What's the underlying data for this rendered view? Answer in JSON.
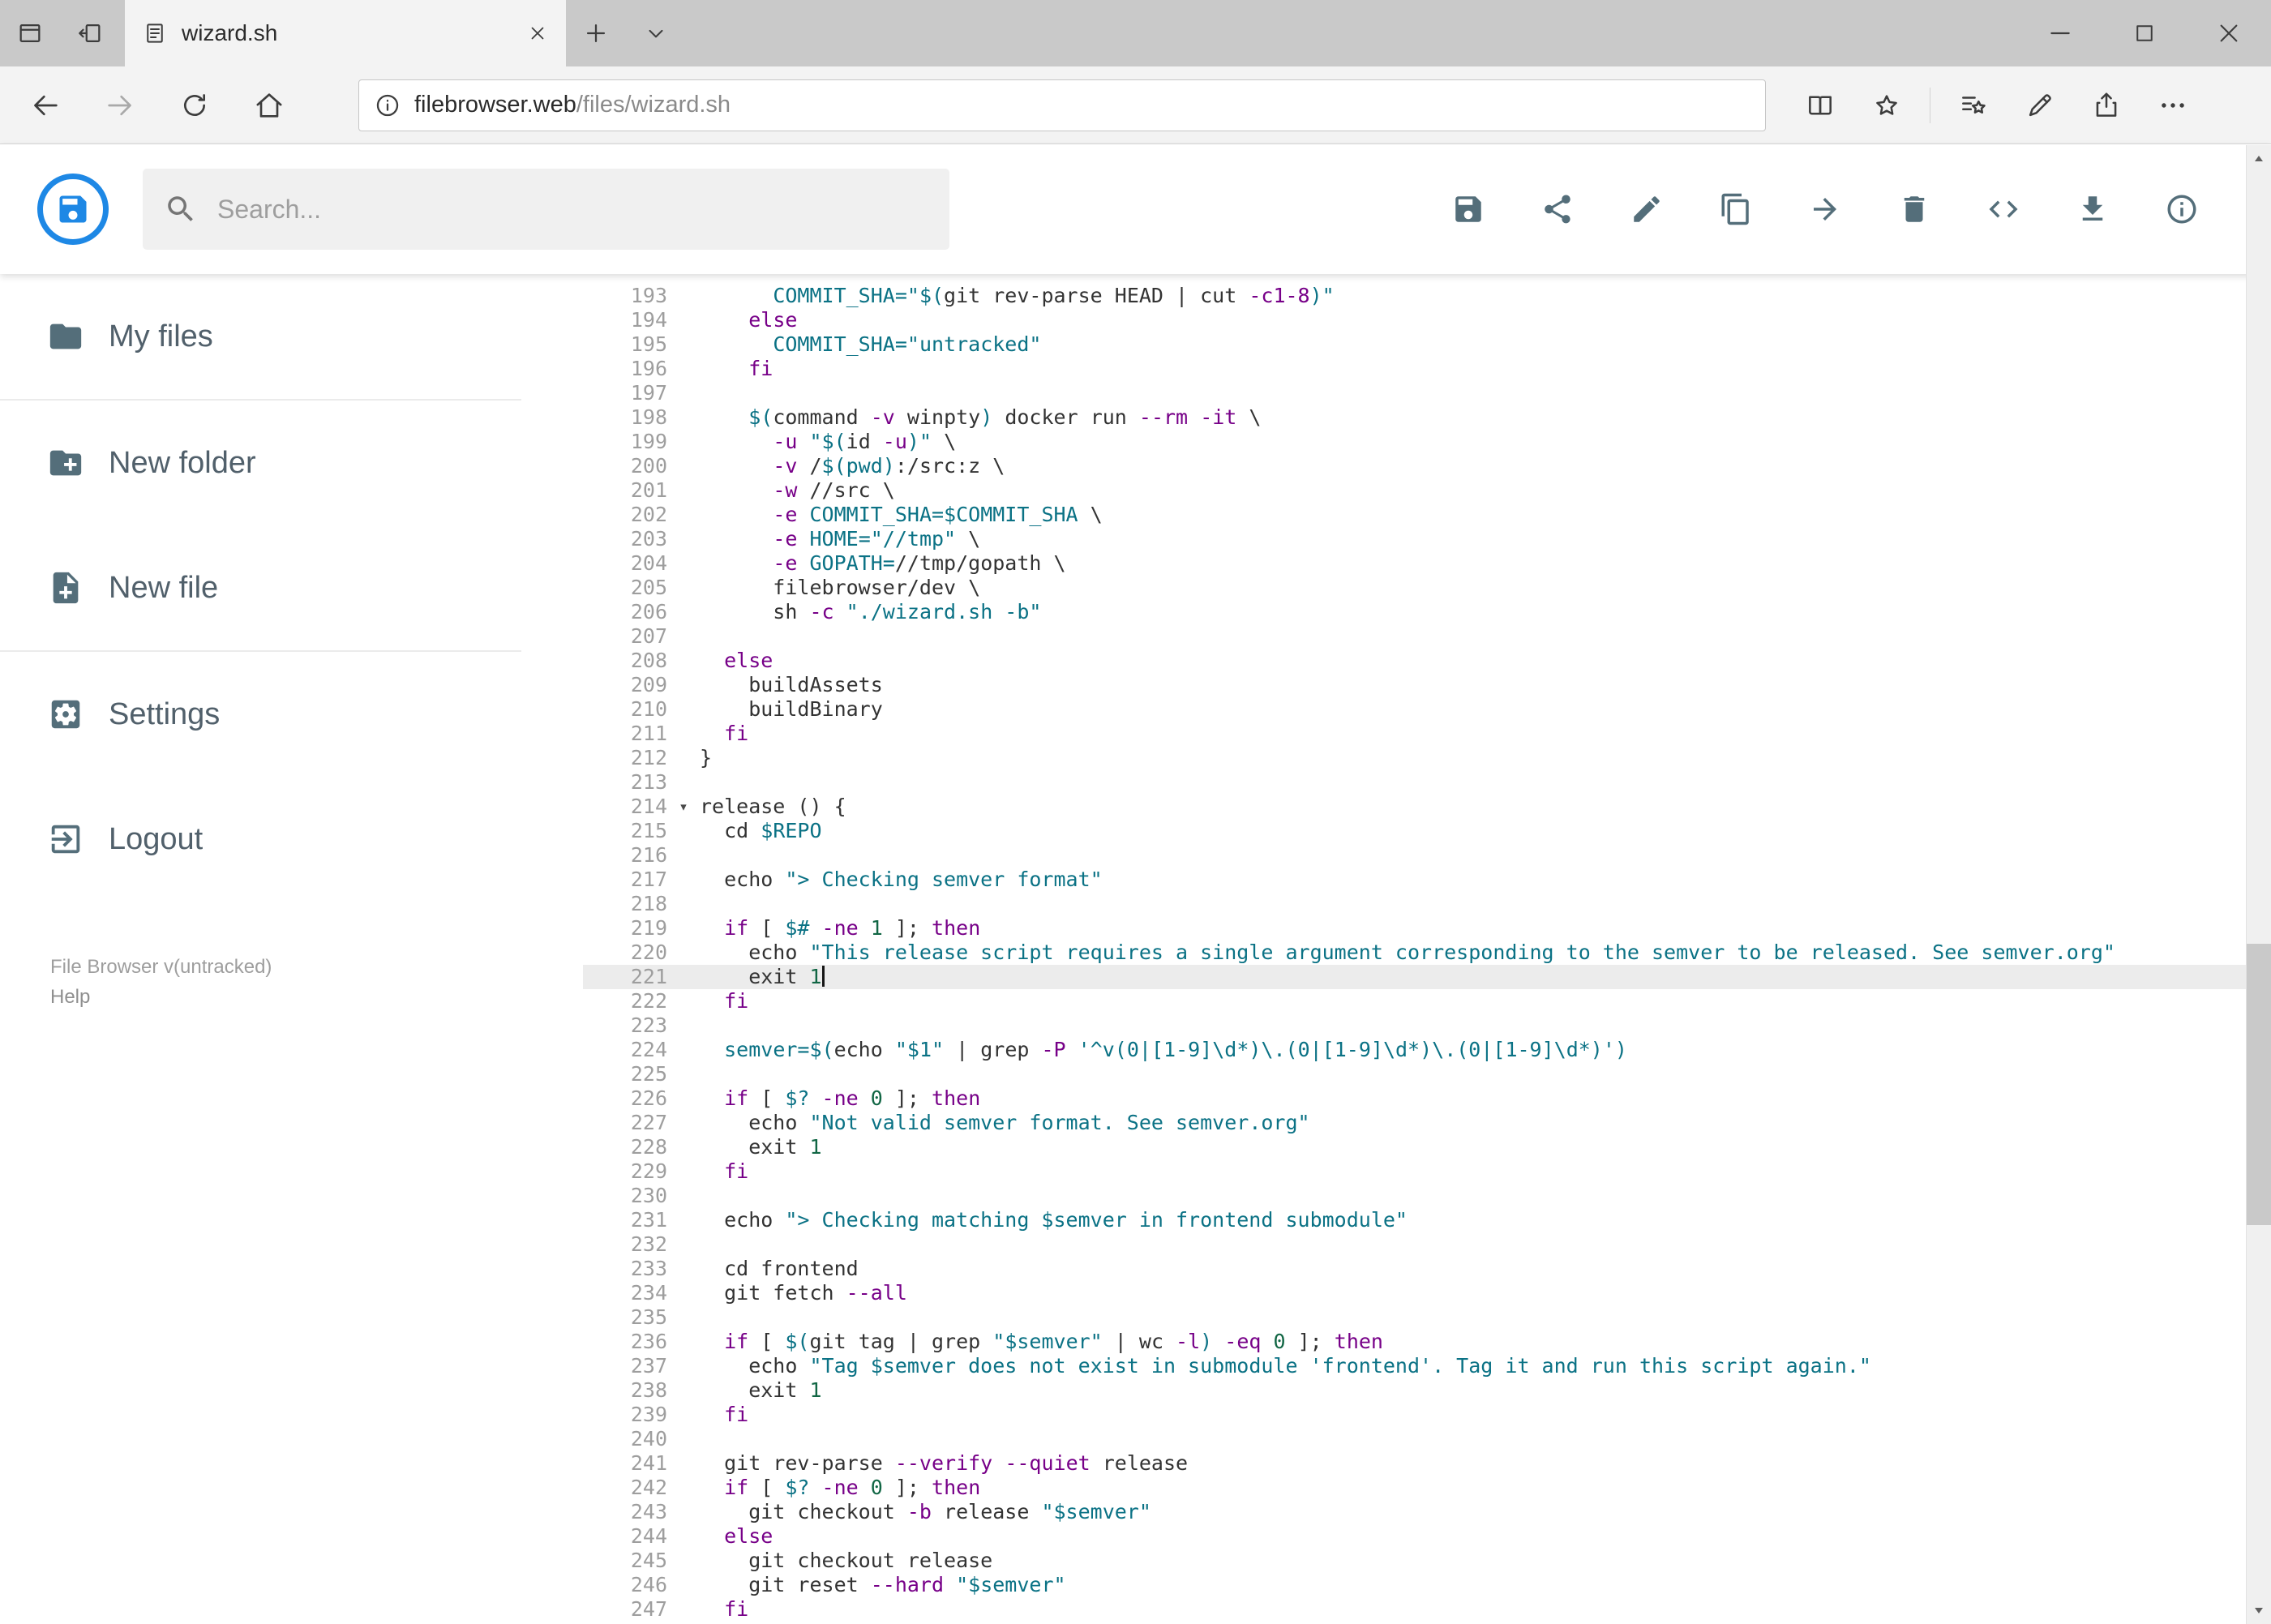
{
  "browser": {
    "tab_title": "wizard.sh",
    "url_host": "filebrowser.web",
    "url_path": "/files/wizard.sh"
  },
  "header": {
    "search_placeholder": "Search...",
    "toolbar_icons": [
      "save-icon",
      "share-icon",
      "rename-icon",
      "copy-icon",
      "move-icon",
      "delete-icon",
      "code-icon",
      "download-icon",
      "info-icon"
    ]
  },
  "sidebar": {
    "items": [
      {
        "label": "My files",
        "icon": "folder-icon"
      },
      {
        "label": "New folder",
        "icon": "new-folder-icon"
      },
      {
        "label": "New file",
        "icon": "new-file-icon"
      },
      {
        "label": "Settings",
        "icon": "settings-icon"
      },
      {
        "label": "Logout",
        "icon": "logout-icon"
      }
    ],
    "footer_version": "File Browser v(untracked)",
    "footer_help": "Help"
  },
  "editor": {
    "active_line": 221,
    "cursor_line": 221,
    "fold_marker_line": 214,
    "fold_marker_glyph": "▾",
    "colors": {
      "plain": "#333333",
      "keyword": "#770088",
      "string_var": "#0b7285",
      "number": "#116644",
      "line_number": "#9e9e9e",
      "active_line_bg": "#ececec"
    },
    "lines": [
      {
        "n": 193,
        "t": [
          [
            "p",
            "      "
          ],
          [
            "t",
            "COMMIT_SHA="
          ],
          [
            "t",
            "\"$("
          ],
          [
            "p",
            "git rev-parse HEAD | cut "
          ],
          [
            "k",
            "-c1-8"
          ],
          [
            "t",
            ")\""
          ]
        ]
      },
      {
        "n": 194,
        "t": [
          [
            "p",
            "    "
          ],
          [
            "k",
            "else"
          ]
        ]
      },
      {
        "n": 195,
        "t": [
          [
            "p",
            "      "
          ],
          [
            "t",
            "COMMIT_SHA="
          ],
          [
            "t",
            "\"untracked\""
          ]
        ]
      },
      {
        "n": 196,
        "t": [
          [
            "p",
            "    "
          ],
          [
            "k",
            "fi"
          ]
        ]
      },
      {
        "n": 197,
        "t": []
      },
      {
        "n": 198,
        "t": [
          [
            "p",
            "    "
          ],
          [
            "t",
            "$("
          ],
          [
            "p",
            "command "
          ],
          [
            "k",
            "-v"
          ],
          [
            "p",
            " winpty"
          ],
          [
            "t",
            ")"
          ],
          [
            "p",
            " docker run "
          ],
          [
            "k",
            "--rm"
          ],
          [
            "p",
            " "
          ],
          [
            "k",
            "-it"
          ],
          [
            "p",
            " \\"
          ]
        ]
      },
      {
        "n": 199,
        "t": [
          [
            "p",
            "      "
          ],
          [
            "k",
            "-u"
          ],
          [
            "p",
            " "
          ],
          [
            "t",
            "\"$("
          ],
          [
            "p",
            "id "
          ],
          [
            "k",
            "-u"
          ],
          [
            "t",
            ")\""
          ],
          [
            "p",
            " \\"
          ]
        ]
      },
      {
        "n": 200,
        "t": [
          [
            "p",
            "      "
          ],
          [
            "k",
            "-v"
          ],
          [
            "p",
            " /"
          ],
          [
            "t",
            "$(pwd)"
          ],
          [
            "p",
            ":/src:z \\"
          ]
        ]
      },
      {
        "n": 201,
        "t": [
          [
            "p",
            "      "
          ],
          [
            "k",
            "-w"
          ],
          [
            "p",
            " //src \\"
          ]
        ]
      },
      {
        "n": 202,
        "t": [
          [
            "p",
            "      "
          ],
          [
            "k",
            "-e"
          ],
          [
            "p",
            " "
          ],
          [
            "t",
            "COMMIT_SHA=$COMMIT_SHA"
          ],
          [
            "p",
            " \\"
          ]
        ]
      },
      {
        "n": 203,
        "t": [
          [
            "p",
            "      "
          ],
          [
            "k",
            "-e"
          ],
          [
            "p",
            " "
          ],
          [
            "t",
            "HOME=\"//tmp\""
          ],
          [
            "p",
            " \\"
          ]
        ]
      },
      {
        "n": 204,
        "t": [
          [
            "p",
            "      "
          ],
          [
            "k",
            "-e"
          ],
          [
            "p",
            " "
          ],
          [
            "t",
            "GOPATH="
          ],
          [
            "p",
            "//tmp/gopath \\"
          ]
        ]
      },
      {
        "n": 205,
        "t": [
          [
            "p",
            "      filebrowser/dev \\"
          ]
        ]
      },
      {
        "n": 206,
        "t": [
          [
            "p",
            "      sh "
          ],
          [
            "k",
            "-c"
          ],
          [
            "p",
            " "
          ],
          [
            "t",
            "\"./wizard.sh -b\""
          ]
        ]
      },
      {
        "n": 207,
        "t": []
      },
      {
        "n": 208,
        "t": [
          [
            "p",
            "  "
          ],
          [
            "k",
            "else"
          ]
        ]
      },
      {
        "n": 209,
        "t": [
          [
            "p",
            "    buildAssets"
          ]
        ]
      },
      {
        "n": 210,
        "t": [
          [
            "p",
            "    buildBinary"
          ]
        ]
      },
      {
        "n": 211,
        "t": [
          [
            "p",
            "  "
          ],
          [
            "k",
            "fi"
          ]
        ]
      },
      {
        "n": 212,
        "t": [
          [
            "p",
            "}"
          ]
        ]
      },
      {
        "n": 213,
        "t": []
      },
      {
        "n": 214,
        "t": [
          [
            "p",
            "release () {"
          ]
        ]
      },
      {
        "n": 215,
        "t": [
          [
            "p",
            "  cd "
          ],
          [
            "t",
            "$REPO"
          ]
        ]
      },
      {
        "n": 216,
        "t": []
      },
      {
        "n": 217,
        "t": [
          [
            "p",
            "  echo "
          ],
          [
            "t",
            "\"> Checking semver format\""
          ]
        ]
      },
      {
        "n": 218,
        "t": []
      },
      {
        "n": 219,
        "t": [
          [
            "p",
            "  "
          ],
          [
            "k",
            "if"
          ],
          [
            "p",
            " [ "
          ],
          [
            "t",
            "$#"
          ],
          [
            "p",
            " "
          ],
          [
            "k",
            "-ne"
          ],
          [
            "p",
            " "
          ],
          [
            "n",
            "1"
          ],
          [
            "p",
            " ]; "
          ],
          [
            "k",
            "then"
          ]
        ]
      },
      {
        "n": 220,
        "t": [
          [
            "p",
            "    echo "
          ],
          [
            "t",
            "\"This release script requires a single argument corresponding to the semver to be released. See semver.org\""
          ]
        ]
      },
      {
        "n": 221,
        "t": [
          [
            "p",
            "    exit "
          ],
          [
            "n",
            "1"
          ]
        ]
      },
      {
        "n": 222,
        "t": [
          [
            "p",
            "  "
          ],
          [
            "k",
            "fi"
          ]
        ]
      },
      {
        "n": 223,
        "t": []
      },
      {
        "n": 224,
        "t": [
          [
            "p",
            "  "
          ],
          [
            "t",
            "semver=$("
          ],
          [
            "p",
            "echo "
          ],
          [
            "t",
            "\"$1\""
          ],
          [
            "p",
            " | grep "
          ],
          [
            "k",
            "-P"
          ],
          [
            "p",
            " "
          ],
          [
            "t",
            "'^v(0|[1-9]\\d*)\\.(0|[1-9]\\d*)\\.(0|[1-9]\\d*)'"
          ],
          [
            "t",
            ")"
          ]
        ]
      },
      {
        "n": 225,
        "t": []
      },
      {
        "n": 226,
        "t": [
          [
            "p",
            "  "
          ],
          [
            "k",
            "if"
          ],
          [
            "p",
            " [ "
          ],
          [
            "t",
            "$?"
          ],
          [
            "p",
            " "
          ],
          [
            "k",
            "-ne"
          ],
          [
            "p",
            " "
          ],
          [
            "n",
            "0"
          ],
          [
            "p",
            " ]; "
          ],
          [
            "k",
            "then"
          ]
        ]
      },
      {
        "n": 227,
        "t": [
          [
            "p",
            "    echo "
          ],
          [
            "t",
            "\"Not valid semver format. See semver.org\""
          ]
        ]
      },
      {
        "n": 228,
        "t": [
          [
            "p",
            "    exit "
          ],
          [
            "n",
            "1"
          ]
        ]
      },
      {
        "n": 229,
        "t": [
          [
            "p",
            "  "
          ],
          [
            "k",
            "fi"
          ]
        ]
      },
      {
        "n": 230,
        "t": []
      },
      {
        "n": 231,
        "t": [
          [
            "p",
            "  echo "
          ],
          [
            "t",
            "\"> Checking matching $semver in frontend submodule\""
          ]
        ]
      },
      {
        "n": 232,
        "t": []
      },
      {
        "n": 233,
        "t": [
          [
            "p",
            "  cd frontend"
          ]
        ]
      },
      {
        "n": 234,
        "t": [
          [
            "p",
            "  git fetch "
          ],
          [
            "k",
            "--all"
          ]
        ]
      },
      {
        "n": 235,
        "t": []
      },
      {
        "n": 236,
        "t": [
          [
            "p",
            "  "
          ],
          [
            "k",
            "if"
          ],
          [
            "p",
            " [ "
          ],
          [
            "t",
            "$("
          ],
          [
            "p",
            "git tag | grep "
          ],
          [
            "t",
            "\"$semver\""
          ],
          [
            "p",
            " | wc "
          ],
          [
            "k",
            "-l"
          ],
          [
            "t",
            ")"
          ],
          [
            "p",
            " "
          ],
          [
            "k",
            "-eq"
          ],
          [
            "p",
            " "
          ],
          [
            "n",
            "0"
          ],
          [
            "p",
            " ]; "
          ],
          [
            "k",
            "then"
          ]
        ]
      },
      {
        "n": 237,
        "t": [
          [
            "p",
            "    echo "
          ],
          [
            "t",
            "\"Tag $semver does not exist in submodule 'frontend'. Tag it and run this script again.\""
          ]
        ]
      },
      {
        "n": 238,
        "t": [
          [
            "p",
            "    exit "
          ],
          [
            "n",
            "1"
          ]
        ]
      },
      {
        "n": 239,
        "t": [
          [
            "p",
            "  "
          ],
          [
            "k",
            "fi"
          ]
        ]
      },
      {
        "n": 240,
        "t": []
      },
      {
        "n": 241,
        "t": [
          [
            "p",
            "  git rev-parse "
          ],
          [
            "k",
            "--verify"
          ],
          [
            "p",
            " "
          ],
          [
            "k",
            "--quiet"
          ],
          [
            "p",
            " release"
          ]
        ]
      },
      {
        "n": 242,
        "t": [
          [
            "p",
            "  "
          ],
          [
            "k",
            "if"
          ],
          [
            "p",
            " [ "
          ],
          [
            "t",
            "$?"
          ],
          [
            "p",
            " "
          ],
          [
            "k",
            "-ne"
          ],
          [
            "p",
            " "
          ],
          [
            "n",
            "0"
          ],
          [
            "p",
            " ]; "
          ],
          [
            "k",
            "then"
          ]
        ]
      },
      {
        "n": 243,
        "t": [
          [
            "p",
            "    git checkout "
          ],
          [
            "k",
            "-b"
          ],
          [
            "p",
            " release "
          ],
          [
            "t",
            "\"$semver\""
          ]
        ]
      },
      {
        "n": 244,
        "t": [
          [
            "p",
            "  "
          ],
          [
            "k",
            "else"
          ]
        ]
      },
      {
        "n": 245,
        "t": [
          [
            "p",
            "    git checkout release"
          ]
        ]
      },
      {
        "n": 246,
        "t": [
          [
            "p",
            "    git reset "
          ],
          [
            "k",
            "--hard"
          ],
          [
            "p",
            " "
          ],
          [
            "t",
            "\"$semver\""
          ]
        ]
      },
      {
        "n": 247,
        "t": [
          [
            "p",
            "  "
          ],
          [
            "k",
            "fi"
          ]
        ]
      }
    ]
  }
}
